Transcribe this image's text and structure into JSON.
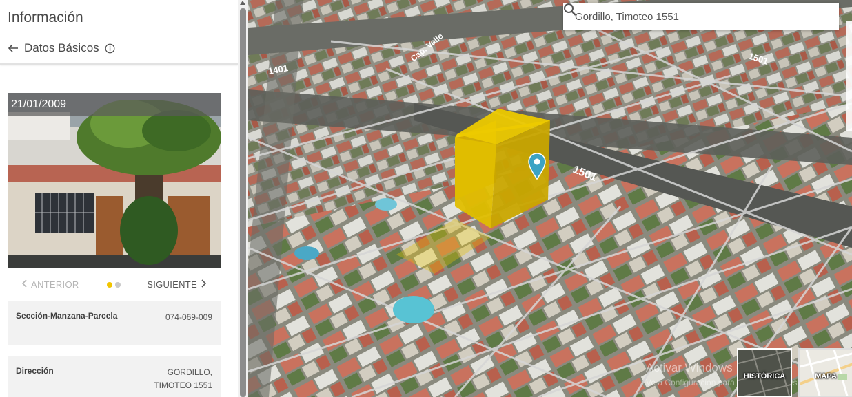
{
  "panel": {
    "title": "Información",
    "back_label": "Datos Básicos"
  },
  "photo": {
    "date": "21/01/2009"
  },
  "carousel": {
    "prev_label": "ANTERIOR",
    "next_label": "SIGUIENTE",
    "dots": 2,
    "active_dot": 1
  },
  "info": [
    {
      "label": "Sección-Manzana-Parcela",
      "value_line1": "074-069-009",
      "value_line2": ""
    },
    {
      "label": "Dirección",
      "value_line1": "GORDILLO,",
      "value_line2": "TIMOTEO 1551"
    }
  ],
  "map": {
    "search_value": "Gordillo, Timoteo 1551",
    "street_number_label": "1501",
    "street_label_top_left": "1401",
    "street_label_rotated": "Cap. Valle",
    "street_label_top_right": "1501",
    "watermark_line1": "Activar Windows",
    "watermark_line2": "Ve a Configuración para activar Windows.",
    "basemaps": [
      {
        "label": "HISTÓRICA"
      },
      {
        "label": "MAPA"
      }
    ],
    "colors": {
      "building": "#e8c200",
      "marker": "#3ca3c4"
    }
  }
}
